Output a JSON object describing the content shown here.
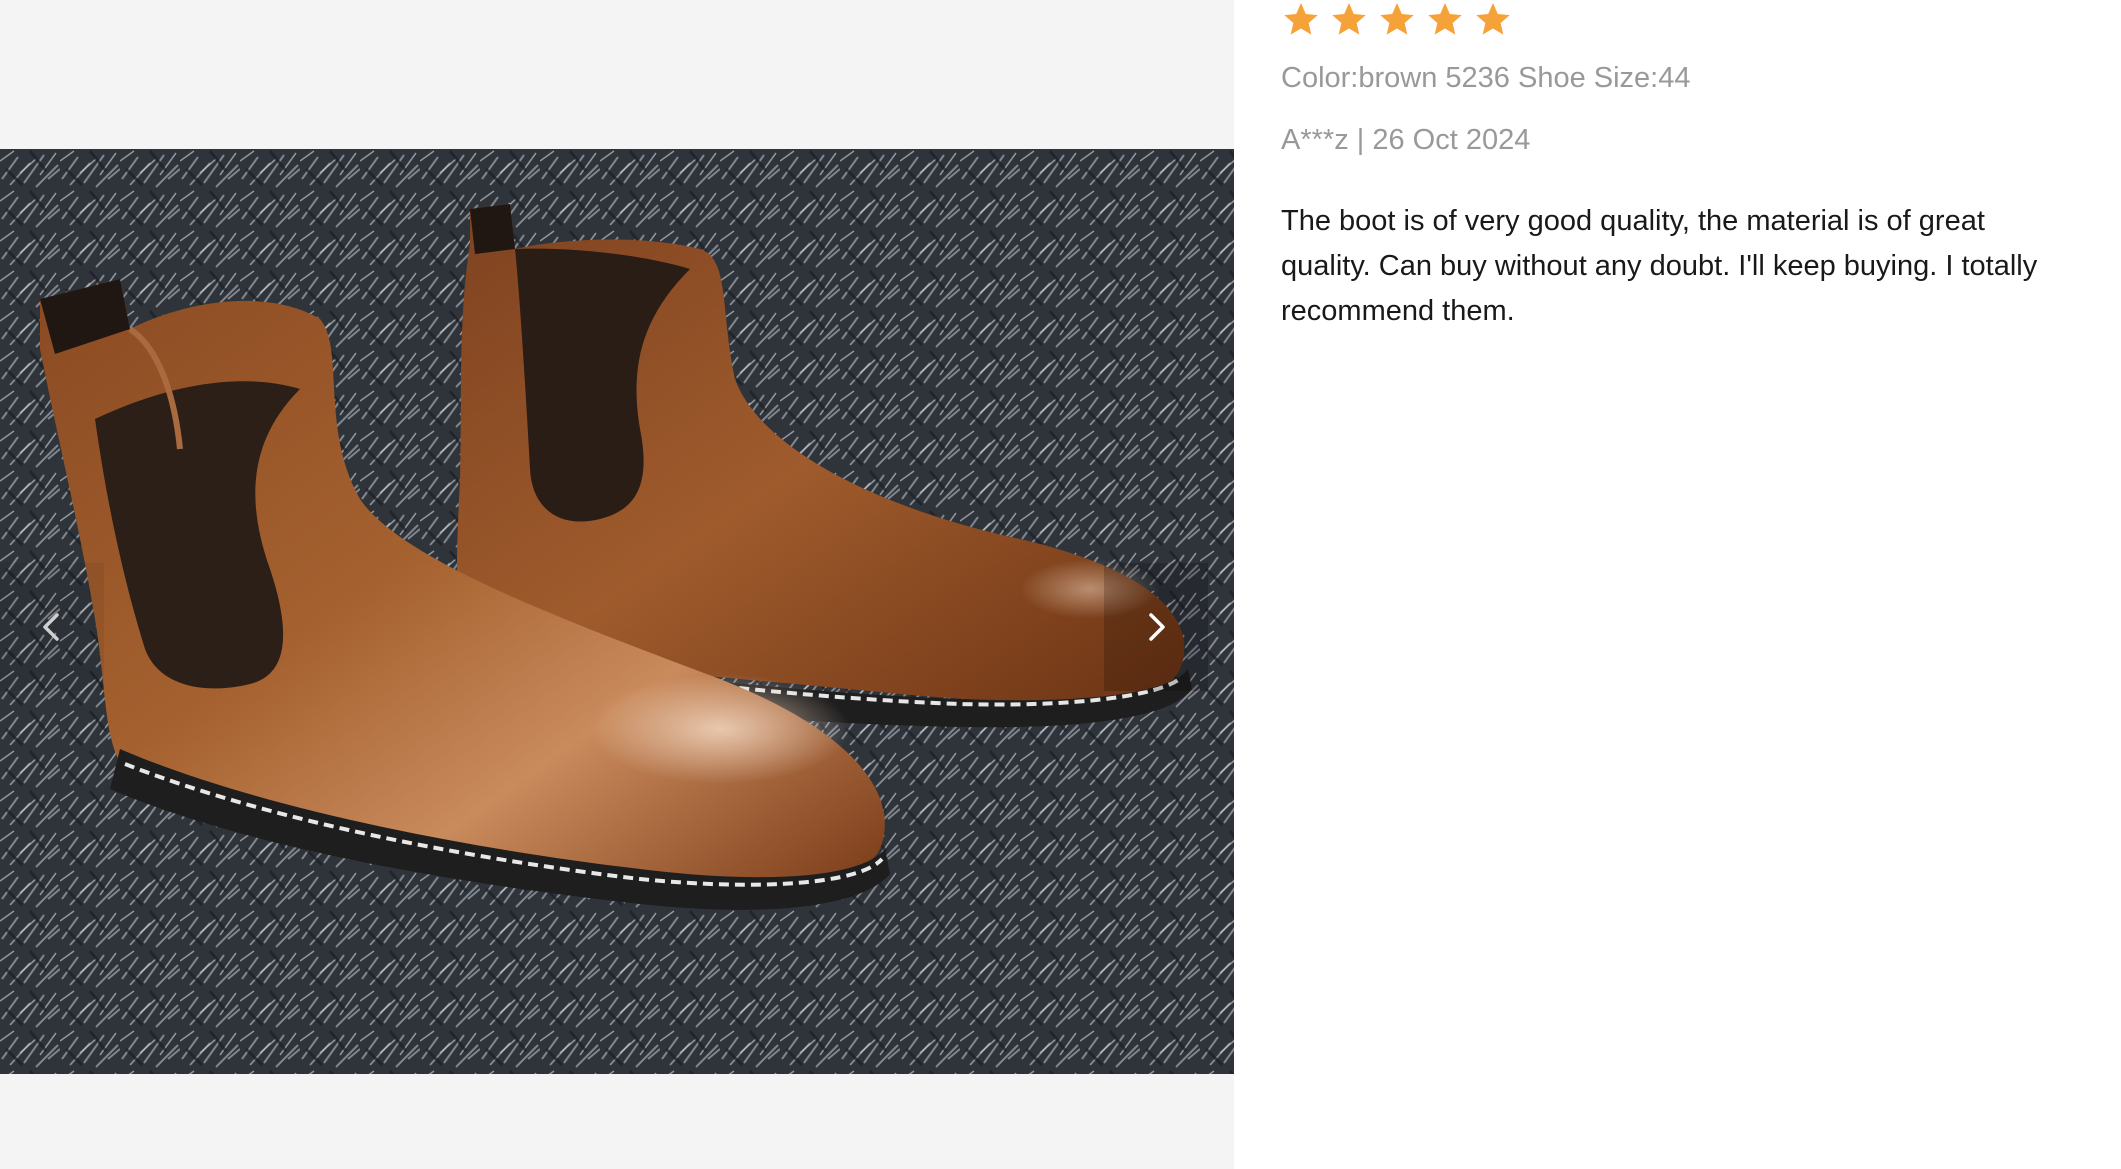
{
  "review": {
    "rating": 5,
    "rating_max": 5,
    "star_color": "#F6A23A",
    "sku_info": "Color:brown 5236 Shoe Size:44",
    "author_date": "A***z | 26 Oct 2024",
    "text": "The boot is of very good quality, the material is of great quality. Can buy without any doubt. I'll keep buying. I totally recommend them."
  },
  "gallery": {
    "prev_icon": "chevron-left-icon",
    "next_icon": "chevron-right-icon",
    "photo_subject": "review-photo"
  }
}
